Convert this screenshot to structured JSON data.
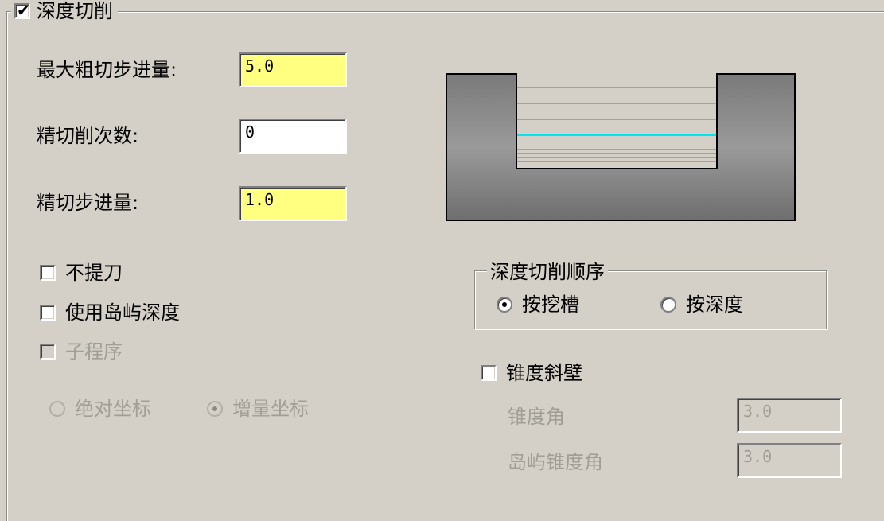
{
  "group": {
    "title": "深度切削",
    "checked": true
  },
  "fields": {
    "max_rough_step_label": "最大粗切步进量:",
    "max_rough_step_value": "5.0",
    "finish_count_label": "精切削次数:",
    "finish_count_value": "0",
    "finish_step_label": "精切步进量:",
    "finish_step_value": "1.0"
  },
  "options": {
    "no_retract_label": "不提刀",
    "use_island_depth_label": "使用岛屿深度",
    "subprogram_label": "子程序",
    "absolute_coord_label": "绝对坐标",
    "incremental_coord_label": "增量坐标"
  },
  "order": {
    "title": "深度切削顺序",
    "by_pocket_label": "按挖槽",
    "by_depth_label": "按深度",
    "selected": "by_pocket"
  },
  "taper": {
    "taper_wall_label": "锥度斜壁",
    "taper_angle_label": "锥度角",
    "taper_angle_value": "3.0",
    "island_taper_angle_label": "岛屿锥度角",
    "island_taper_angle_value": "3.0"
  },
  "colors": {
    "field_highlight": "#ffff80",
    "window_bg": "#d4d0c8",
    "cut_line": "#00e5ee",
    "material": "#8c8c8c"
  },
  "icons": {
    "check": "✔"
  }
}
